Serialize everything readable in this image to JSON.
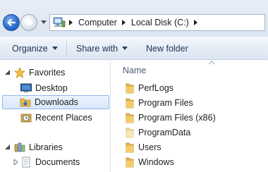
{
  "address_bar": {
    "breadcrumbs": [
      "Computer",
      "Local Disk (C:)"
    ]
  },
  "command_bar": {
    "organize_label": "Organize",
    "share_label": "Share with",
    "new_folder_label": "New folder"
  },
  "nav_pane": {
    "favorites": {
      "label": "Favorites",
      "items": [
        {
          "label": "Desktop",
          "icon": "desktop-icon"
        },
        {
          "label": "Downloads",
          "icon": "downloads-icon",
          "selected": true
        },
        {
          "label": "Recent Places",
          "icon": "recent-places-icon"
        }
      ]
    },
    "libraries": {
      "label": "Libraries",
      "items": [
        {
          "label": "Documents",
          "icon": "documents-icon"
        }
      ]
    }
  },
  "content": {
    "column_header": "Name",
    "files": [
      {
        "name": "PerfLogs"
      },
      {
        "name": "Program Files"
      },
      {
        "name": "Program Files (x86)"
      },
      {
        "name": "ProgramData"
      },
      {
        "name": "Users"
      },
      {
        "name": "Windows"
      }
    ]
  },
  "colors": {
    "selection_fill": "#d7e8fc",
    "selection_border": "#8fb9ec",
    "folder_yellow": "#e8b84a"
  }
}
